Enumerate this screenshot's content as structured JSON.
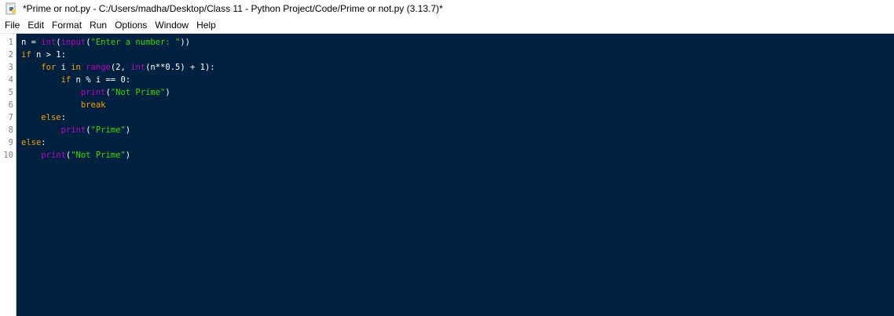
{
  "window": {
    "title": "*Prime or not.py - C:/Users/madha/Desktop/Class 11 - Python Project/Code/Prime or not.py (3.13.7)*"
  },
  "menubar": {
    "items": [
      "File",
      "Edit",
      "Format",
      "Run",
      "Options",
      "Window",
      "Help"
    ]
  },
  "colors": {
    "editor_background": "#002240",
    "keyword": "#ff9d00",
    "builtin": "#c000c0",
    "string": "#3ad900",
    "plain": "#ffffff",
    "line_number": "#808080"
  },
  "editor": {
    "line_numbers": [
      "1",
      "2",
      "3",
      "4",
      "5",
      "6",
      "7",
      "8",
      "9",
      "10"
    ],
    "lines": [
      {
        "tokens": [
          {
            "t": "n = ",
            "k": "plain"
          },
          {
            "t": "int",
            "k": "builtin"
          },
          {
            "t": "(",
            "k": "plain"
          },
          {
            "t": "input",
            "k": "builtin"
          },
          {
            "t": "(",
            "k": "plain"
          },
          {
            "t": "\"Enter a number: \"",
            "k": "string"
          },
          {
            "t": "))",
            "k": "plain"
          }
        ]
      },
      {
        "tokens": [
          {
            "t": "if",
            "k": "keyword"
          },
          {
            "t": " n > 1:",
            "k": "plain"
          }
        ]
      },
      {
        "tokens": [
          {
            "t": "    ",
            "k": "plain"
          },
          {
            "t": "for",
            "k": "keyword"
          },
          {
            "t": " i ",
            "k": "plain"
          },
          {
            "t": "in",
            "k": "keyword"
          },
          {
            "t": " ",
            "k": "plain"
          },
          {
            "t": "range",
            "k": "builtin"
          },
          {
            "t": "(2, ",
            "k": "plain"
          },
          {
            "t": "int",
            "k": "builtin"
          },
          {
            "t": "(n**0.5) + 1):",
            "k": "plain"
          }
        ]
      },
      {
        "tokens": [
          {
            "t": "        ",
            "k": "plain"
          },
          {
            "t": "if",
            "k": "keyword"
          },
          {
            "t": " n % i == 0:",
            "k": "plain"
          }
        ]
      },
      {
        "tokens": [
          {
            "t": "            ",
            "k": "plain"
          },
          {
            "t": "print",
            "k": "builtin"
          },
          {
            "t": "(",
            "k": "plain"
          },
          {
            "t": "\"Not Prime\"",
            "k": "string"
          },
          {
            "t": ")",
            "k": "plain"
          }
        ]
      },
      {
        "tokens": [
          {
            "t": "            ",
            "k": "plain"
          },
          {
            "t": "break",
            "k": "keyword"
          }
        ]
      },
      {
        "tokens": [
          {
            "t": "    ",
            "k": "plain"
          },
          {
            "t": "else",
            "k": "keyword"
          },
          {
            "t": ":",
            "k": "plain"
          }
        ]
      },
      {
        "tokens": [
          {
            "t": "        ",
            "k": "plain"
          },
          {
            "t": "print",
            "k": "builtin"
          },
          {
            "t": "(",
            "k": "plain"
          },
          {
            "t": "\"Prime\"",
            "k": "string"
          },
          {
            "t": ")",
            "k": "plain"
          }
        ]
      },
      {
        "tokens": [
          {
            "t": "else",
            "k": "keyword"
          },
          {
            "t": ":",
            "k": "plain"
          }
        ]
      },
      {
        "tokens": [
          {
            "t": "    ",
            "k": "plain"
          },
          {
            "t": "print",
            "k": "builtin"
          },
          {
            "t": "(",
            "k": "plain"
          },
          {
            "t": "\"Not Prime\"",
            "k": "string"
          },
          {
            "t": ")",
            "k": "plain"
          }
        ]
      }
    ]
  }
}
